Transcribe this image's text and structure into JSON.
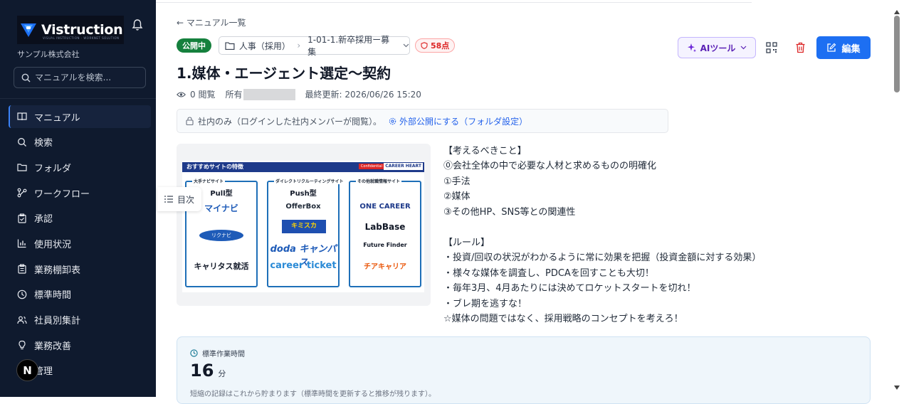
{
  "sidebar": {
    "logo_text": "Vistruction",
    "logo_sub": "VISUAL INSTRUCTION · WORKNET SOLUTION",
    "company": "サンプル株式会社",
    "search_placeholder": "マニュアルを検索...",
    "items": [
      {
        "label": "マニュアル",
        "icon": "book-icon",
        "active": true
      },
      {
        "label": "検索",
        "icon": "search-icon"
      },
      {
        "label": "フォルダ",
        "icon": "folder-icon"
      },
      {
        "label": "ワークフロー",
        "icon": "workflow-icon"
      },
      {
        "label": "承認",
        "icon": "clipboard-check-icon"
      },
      {
        "label": "使用状況",
        "icon": "bar-chart-icon"
      },
      {
        "label": "業務棚卸表",
        "icon": "clipboard-list-icon"
      },
      {
        "label": "標準時間",
        "icon": "clock-icon"
      },
      {
        "label": "社員別集計",
        "icon": "users-icon"
      },
      {
        "label": "業務改善",
        "icon": "lightbulb-icon"
      },
      {
        "label": "管理",
        "icon": "settings-icon"
      }
    ],
    "avatar_initial": "N"
  },
  "header": {
    "back_label": "← マニュアル一覧",
    "status_badge": "公開中",
    "folder_path": [
      "人事（採用）",
      "1-01-1.新卒採用ー募集"
    ],
    "score_label": "58点",
    "title": "1.媒体・エージェント選定〜契約",
    "views": "0 閲覧",
    "owner_label": "所有",
    "last_updated": "最終更新: 2026/06/26 15:20",
    "visibility_text": "社内のみ（ログインした社内メンバーが閲覧）。",
    "visibility_link": "外部公開にする（フォルダ設定）"
  },
  "toolbar": {
    "ai_tool_label": "AIツール",
    "edit_label": "編集"
  },
  "toc_label": "目次",
  "slide": {
    "header": "おすすめサイトの特徴",
    "confidential": "Confidential",
    "brand": "CAREER HEART",
    "columns": [
      {
        "caption": "大手ナビサイト",
        "title": "Pull型",
        "brands": [
          "マイナビ",
          "リクナビ",
          "キャリタス就活"
        ]
      },
      {
        "caption": "ダイレクトリクルーティングサイト",
        "title": "Push型",
        "brands": [
          "OfferBox",
          "キミスカ",
          "doda キャンパス",
          "career ticket"
        ]
      },
      {
        "caption": "その他就職情報サイト",
        "title": "",
        "brands": [
          "ONE CAREER",
          "LabBase",
          "Future Finder",
          "チアキャリア"
        ]
      }
    ]
  },
  "content_lines": [
    "【考えるべきこと】",
    "⓪会社全体の中で必要な人材と求めるものの明確化",
    "①手法",
    "②媒体",
    "③その他HP、SNS等との関連性",
    "",
    "【ルール】",
    "・投資/回収の状況がわかるように常に効果を把握（投資金額に対する効果）",
    "・様々な媒体を調査し、PDCAを回すことも大切！",
    "・毎年3月、4月あたりには決めてロケットスタートを切れ！",
    "・ブレ期を逃すな！",
    "☆媒体の問題ではなく、採用戦略のコンセプトを考えろ！"
  ],
  "standard_time": {
    "label": "標準作業時間",
    "value": "16",
    "unit": "分",
    "note": "短縮の記録はこれから貯まります（標準時間を更新すると推移が残ります）。"
  },
  "colors": {
    "sidebar_bg": "#0f1a2e",
    "accent": "#1d6ff2",
    "status_green": "#15803d",
    "score_red": "#dc2626",
    "ai_purple": "#5b21b6"
  }
}
